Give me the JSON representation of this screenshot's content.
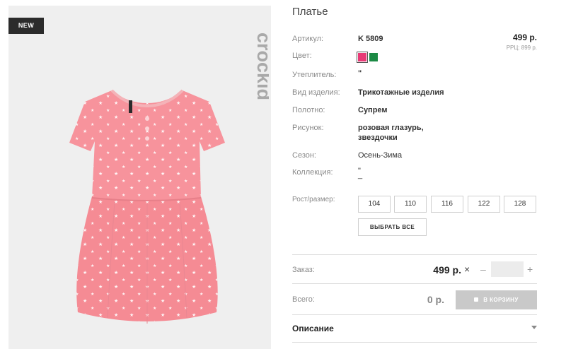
{
  "badge": "NEW",
  "brand": "crockid",
  "product": {
    "title": "Платье",
    "price": "499 р.",
    "rrp": "РРЦ: 899 р."
  },
  "specs": {
    "article_label": "Артикул:",
    "article_value": "K 5809",
    "color_label": "Цвет:",
    "colors": [
      "#e83a76",
      "#1c8a45"
    ],
    "insulation_label": "Утеплитель:",
    "insulation_value": "\"",
    "type_label": "Вид изделия:",
    "type_value": "Трикотажные изделия",
    "fabric_label": "Полотно:",
    "fabric_value": "Супрем",
    "pattern_label": "Рисунок:",
    "pattern_line1": "розовая глазурь,",
    "pattern_line2": "звездочки",
    "season_label": "Сезон:",
    "season_value": "Осень-Зима",
    "collection_label": "Коллекция:",
    "collection_line1": "\"",
    "collection_line2": "_"
  },
  "size": {
    "label": "Рост/размер:",
    "options": [
      "104",
      "110",
      "116",
      "122",
      "128"
    ],
    "select_all": "ВЫБРАТЬ ВСЕ"
  },
  "order": {
    "label": "Заказ:",
    "price": "499 р.",
    "times": "×",
    "minus": "–",
    "plus": "+",
    "quantity": ""
  },
  "total": {
    "label": "Всего:",
    "value": "0 р.",
    "cart_button": "В КОРЗИНУ"
  },
  "description": {
    "title": "Описание"
  }
}
